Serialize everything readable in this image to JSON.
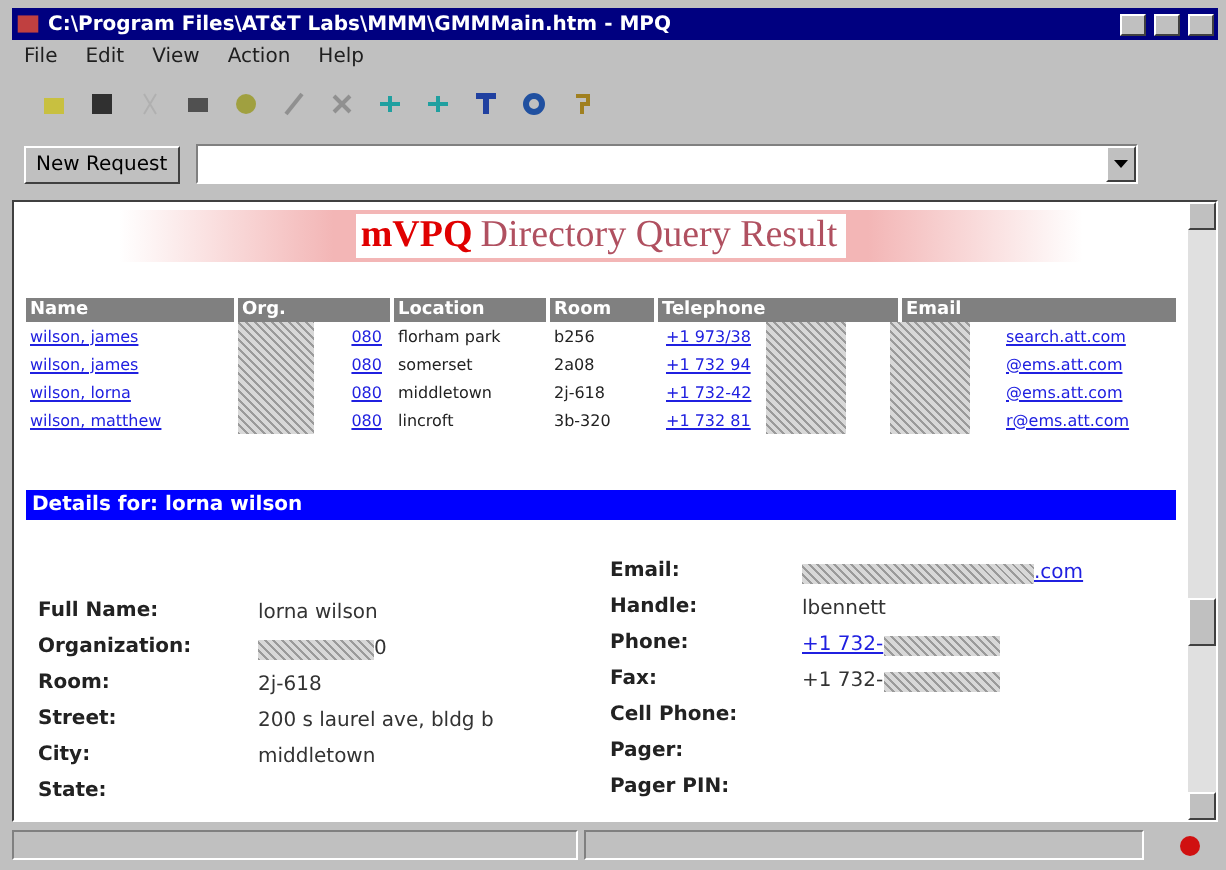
{
  "window": {
    "title": "C:\\Program Files\\AT&T Labs\\MMM\\GMMMain.htm - MPQ"
  },
  "menu": [
    "File",
    "Edit",
    "View",
    "Action",
    "Help"
  ],
  "query": {
    "button": "New Request"
  },
  "heading": {
    "brand": "mVPQ",
    "title": "Directory Query Result"
  },
  "table": {
    "columns": [
      "Name",
      "Org.",
      "Location",
      "Room",
      "Telephone",
      "Email"
    ],
    "rows": [
      {
        "name": "wilson, james",
        "org": "080",
        "location": "florham park",
        "room": "b256",
        "phone": "+1 973/38",
        "email": "search.att.com"
      },
      {
        "name": "wilson, james",
        "org": "080",
        "location": "somerset",
        "room": "2a08",
        "phone": "+1 732 94",
        "email": "@ems.att.com"
      },
      {
        "name": "wilson, lorna",
        "org": "080",
        "location": "middletown",
        "room": "2j-618",
        "phone": "+1 732-42",
        "email": "@ems.att.com"
      },
      {
        "name": "wilson, matthew",
        "org": "080",
        "location": "lincroft",
        "room": "3b-320",
        "phone": "+1 732 81",
        "email": "r@ems.att.com"
      }
    ]
  },
  "details": {
    "title": "Details for: lorna wilson",
    "left": [
      {
        "label": "Full Name:",
        "value": "lorna wilson",
        "kind": "text"
      },
      {
        "label": "Organization:",
        "value": "0",
        "kind": "redacted"
      },
      {
        "label": "Room:",
        "value": "2j-618",
        "kind": "text"
      },
      {
        "label": "Street:",
        "value": "200 s laurel ave, bldg b",
        "kind": "text"
      },
      {
        "label": "City:",
        "value": "middletown",
        "kind": "text"
      },
      {
        "label": "State:",
        "kind": "text"
      }
    ],
    "right": [
      {
        "label": "Email:",
        "value": ".com",
        "kind": "redacted-link"
      },
      {
        "label": "Handle:",
        "value": "lbennett",
        "kind": "text"
      },
      {
        "label": "Phone:",
        "value": "+1 732-",
        "kind": "link-redacted"
      },
      {
        "label": "Fax:",
        "value": "+1 732-",
        "kind": "text-redacted"
      },
      {
        "label": "Cell Phone:",
        "kind": "text"
      },
      {
        "label": "Pager:",
        "kind": "text"
      },
      {
        "label": "Pager PIN:",
        "kind": "text"
      }
    ]
  }
}
